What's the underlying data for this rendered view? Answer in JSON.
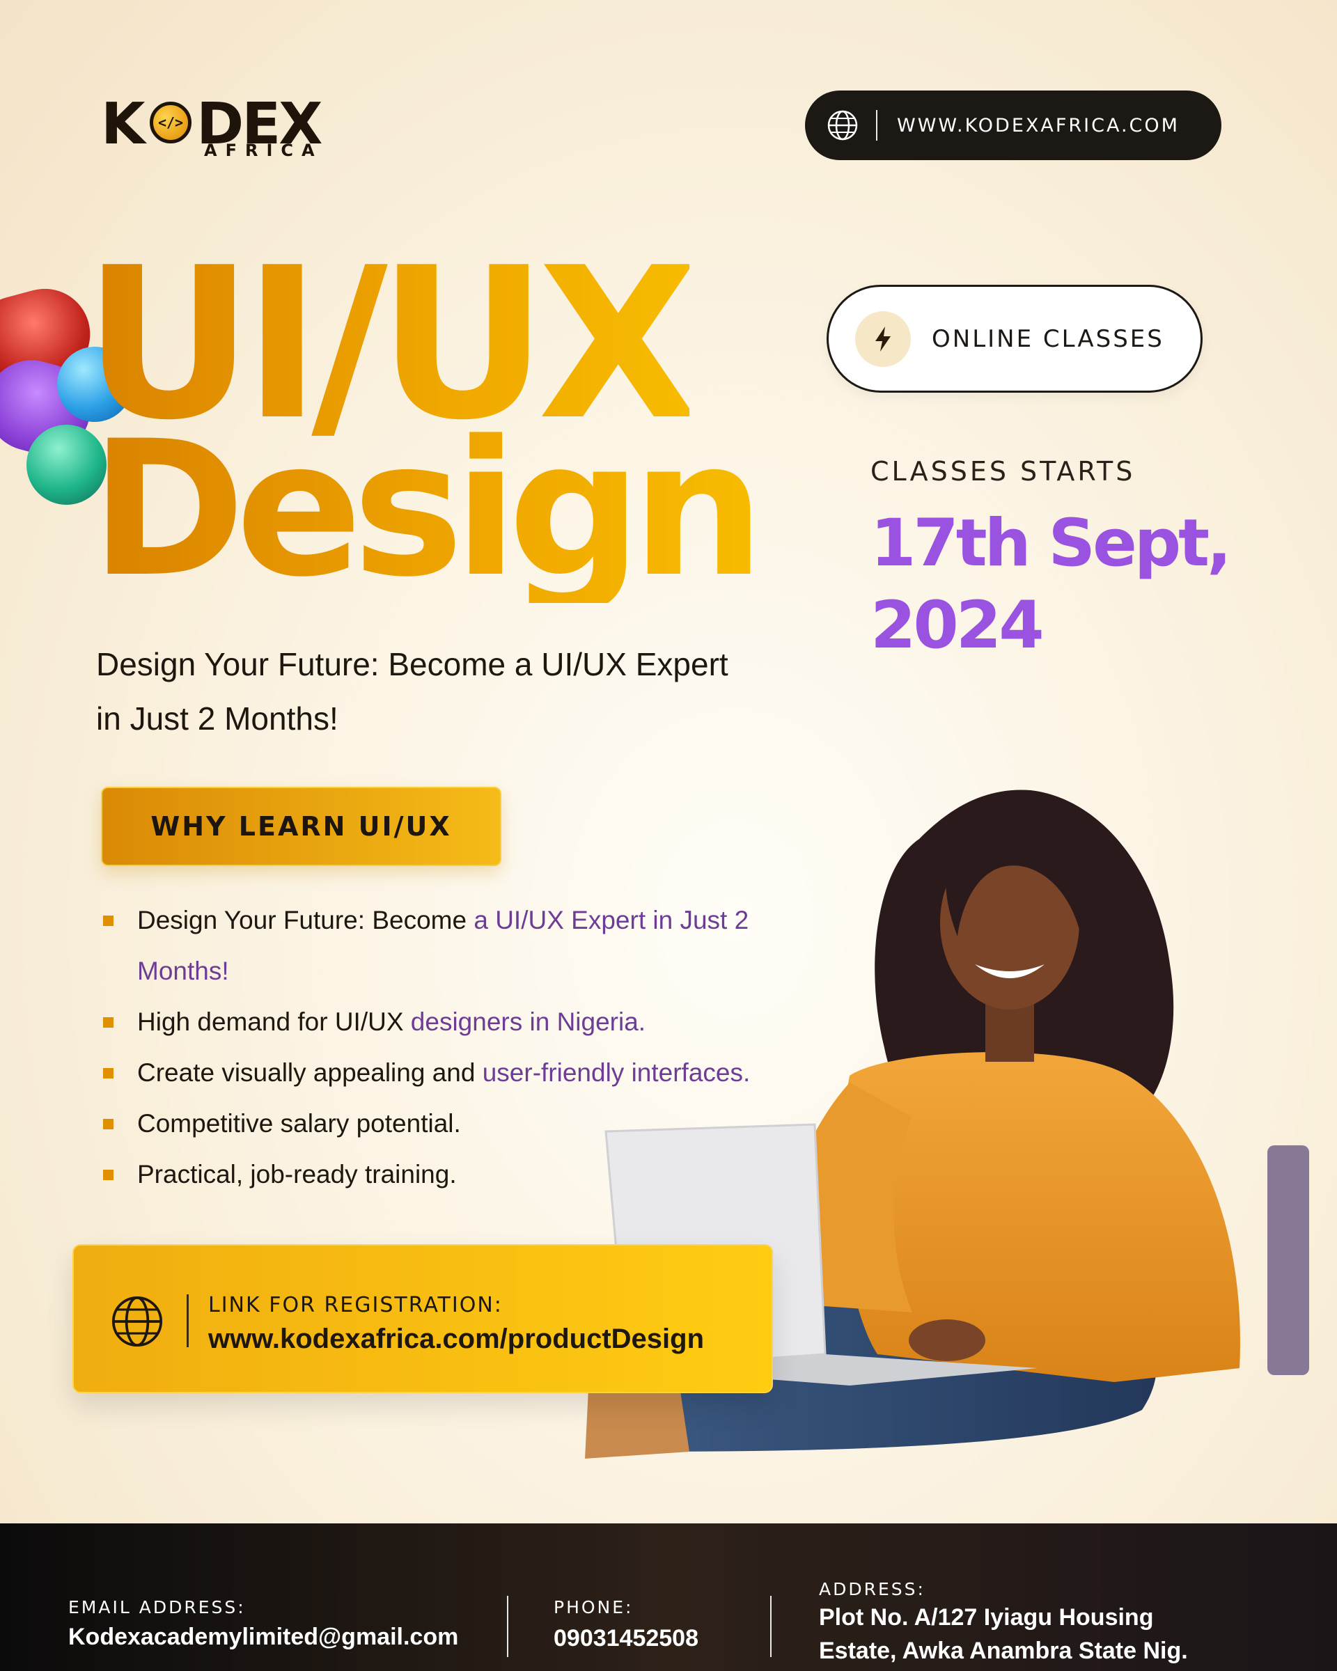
{
  "brand": {
    "logo_word": "KODEX",
    "logo_sub": "AFRICA",
    "website": "WWW.KODEXAFRICA.COM"
  },
  "hero": {
    "title_line1": "UI/UX",
    "title_line2": "Design",
    "subtitle": "Design Your Future: Become a UI/UX Expert in Just 2 Months!"
  },
  "class_info": {
    "mode": "ONLINE CLASSES",
    "starts_label": "CLASSES STARTS",
    "start_date": "17th Sept, 2024"
  },
  "why": {
    "button_label": "WHY LEARN UI/UX",
    "bullets": [
      {
        "plain": "Design Your Future: Become",
        "highlight": " a UI/UX Expert in Just 2 Months!"
      },
      {
        "plain": "High demand for UI/UX",
        "highlight": " designers in Nigeria."
      },
      {
        "plain": "Create visually appealing and",
        "highlight": " user-friendly interfaces."
      },
      {
        "plain": "Competitive salary potential.",
        "highlight": ""
      },
      {
        "plain": "Practical, job-ready training.",
        "highlight": ""
      }
    ]
  },
  "registration": {
    "label": "LINK FOR REGISTRATION:",
    "url": "www.kodexafrica.com/productDesign"
  },
  "footer": {
    "email_label": "EMAIL ADDRESS:",
    "email": "Kodexacademylimited@gmail.com",
    "phone_label": "PHONE:",
    "phone": "09031452508",
    "address_label": "ADDRESS:",
    "address_line1": "Plot No. A/127 Iyiagu Housing",
    "address_line2": "Estate, Awka Anambra State Nig."
  },
  "colors": {
    "accent_orange": "#e69c00",
    "accent_purple": "#9a52e0",
    "dark": "#1c1814"
  }
}
